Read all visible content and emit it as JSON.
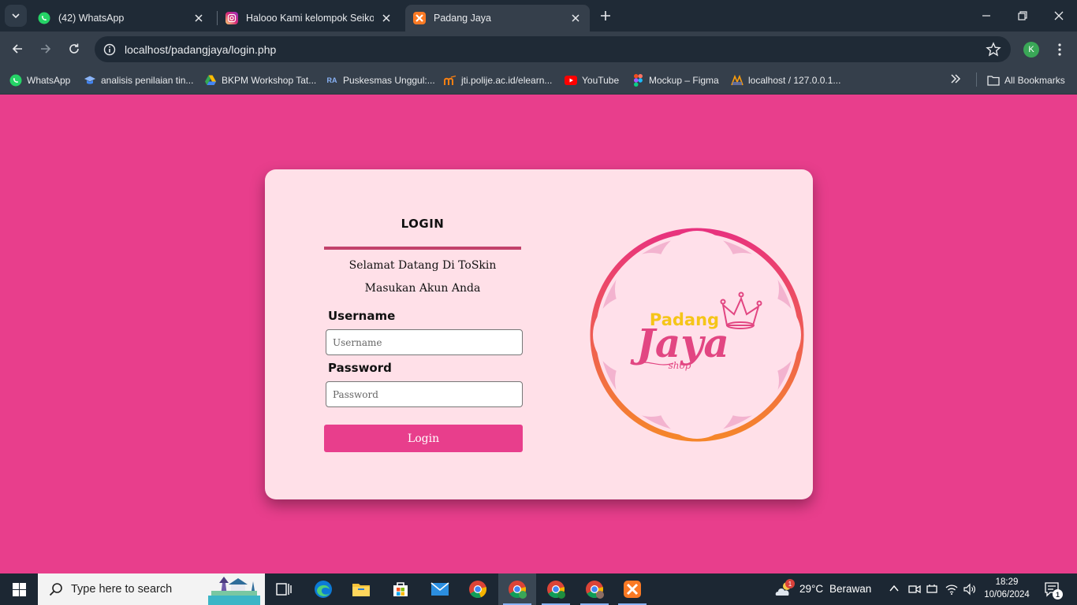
{
  "browser": {
    "tabs": [
      {
        "title": "(42) WhatsApp",
        "icon": "whatsapp-icon"
      },
      {
        "title": "Halooo Kami kelompok Seiko In",
        "icon": "instagram-icon"
      },
      {
        "title": "Padang Jaya",
        "icon": "xampp-icon"
      }
    ],
    "url": "localhost/padangjaya/login.php",
    "profile_initial": "K",
    "bookmarks": [
      {
        "label": "WhatsApp",
        "icon": "whatsapp-icon"
      },
      {
        "label": "analisis penilaian tin...",
        "icon": "graduation-cap-icon"
      },
      {
        "label": "BKPM Workshop Tat...",
        "icon": "google-drive-icon"
      },
      {
        "label": "Puskesmas Unggul:...",
        "icon": "ra-icon",
        "icon_text": "RA"
      },
      {
        "label": "jti.polije.ac.id/elearn...",
        "icon": "moodle-icon"
      },
      {
        "label": "YouTube",
        "icon": "youtube-icon"
      },
      {
        "label": "Mockup – Figma",
        "icon": "figma-icon"
      },
      {
        "label": "localhost / 127.0.0.1...",
        "icon": "phpmyadmin-icon"
      }
    ],
    "all_bookmarks_label": "All Bookmarks"
  },
  "login": {
    "title": "LOGIN",
    "welcome": "Selamat Datang Di ToSkin",
    "subtitle": "Masukan Akun Anda",
    "username_label": "Username",
    "username_placeholder": "Username",
    "password_label": "Password",
    "password_placeholder": "Password",
    "button_label": "Login"
  },
  "logo": {
    "line1": "Padang",
    "line2": "Jaya",
    "line3": "shop"
  },
  "colors": {
    "page_background": "#e83e8c",
    "card_background": "#ffe0e8",
    "button": "#e83e8c",
    "rule": "#c2426b"
  },
  "taskbar": {
    "search_placeholder": "Type here to search",
    "weather_temp": "29°C",
    "weather_text": "Berawan",
    "time": "18:29",
    "date": "10/06/2024",
    "notification_count": "1",
    "weather_badge": "1"
  }
}
